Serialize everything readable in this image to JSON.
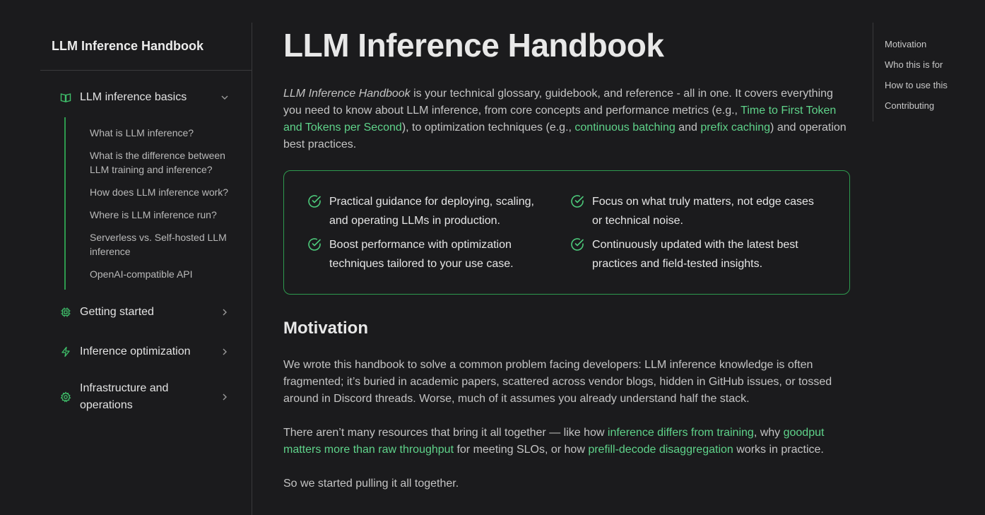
{
  "site": {
    "brand": "LLM Inference Handbook"
  },
  "sidebar": {
    "categories": [
      {
        "label": "LLM inference basics",
        "icon": "book-open-icon",
        "expanded": true,
        "items": [
          "What is LLM inference?",
          "What is the difference between LLM training and inference?",
          "How does LLM inference work?",
          "Where is LLM inference run?",
          "Serverless vs. Self-hosted LLM inference",
          "OpenAI-compatible API"
        ]
      },
      {
        "label": "Getting started",
        "icon": "chip-icon",
        "expanded": false
      },
      {
        "label": "Inference optimization",
        "icon": "lightning-icon",
        "expanded": false
      },
      {
        "label": "Infrastructure and operations",
        "icon": "gear-icon",
        "expanded": false
      }
    ]
  },
  "main": {
    "title": "LLM Inference Handbook",
    "intro": {
      "em": "LLM Inference Handbook",
      "t1": " is your technical glossary, guidebook, and reference - all in one. It covers everything you need to know about LLM inference, from core concepts and performance metrics (e.g., ",
      "link1": "Time to First Token and Tokens per Second",
      "t2": "), to optimization techniques (e.g., ",
      "link2": "continuous batching",
      "t3": " and ",
      "link3": "prefix caching",
      "t4": ") and operation best practices."
    },
    "features": [
      "Practical guidance for deploying, scaling, and operating LLMs in production.",
      "Focus on what truly matters, not edge cases or technical noise.",
      "Boost performance with optimization techniques tailored to your use case.",
      "Continuously updated with the latest best practices and field-tested insights."
    ],
    "motivation": {
      "heading": "Motivation",
      "p1": "We wrote this handbook to solve a common problem facing developers: LLM inference knowledge is often fragmented; it’s buried in academic papers, scattered across vendor blogs, hidden in GitHub issues, or tossed around in Discord threads. Worse, much of it assumes you already understand half the stack.",
      "p2": {
        "t1": "There aren’t many resources that bring it all together — like how ",
        "link1": "inference differs from training",
        "t2": ", why ",
        "link2": "goodput matters more than raw throughput",
        "t3": " for meeting SLOs, or how ",
        "link3": "prefill-decode disaggregation",
        "t4": " works in practice."
      },
      "p3": "So we started pulling it all together."
    }
  },
  "toc": [
    "Motivation",
    "Who this is for",
    "How to use this",
    "Contributing"
  ],
  "colors": {
    "accent": "#5fd38a",
    "border_green": "#2e9a4e",
    "background": "#1b1b1d"
  }
}
